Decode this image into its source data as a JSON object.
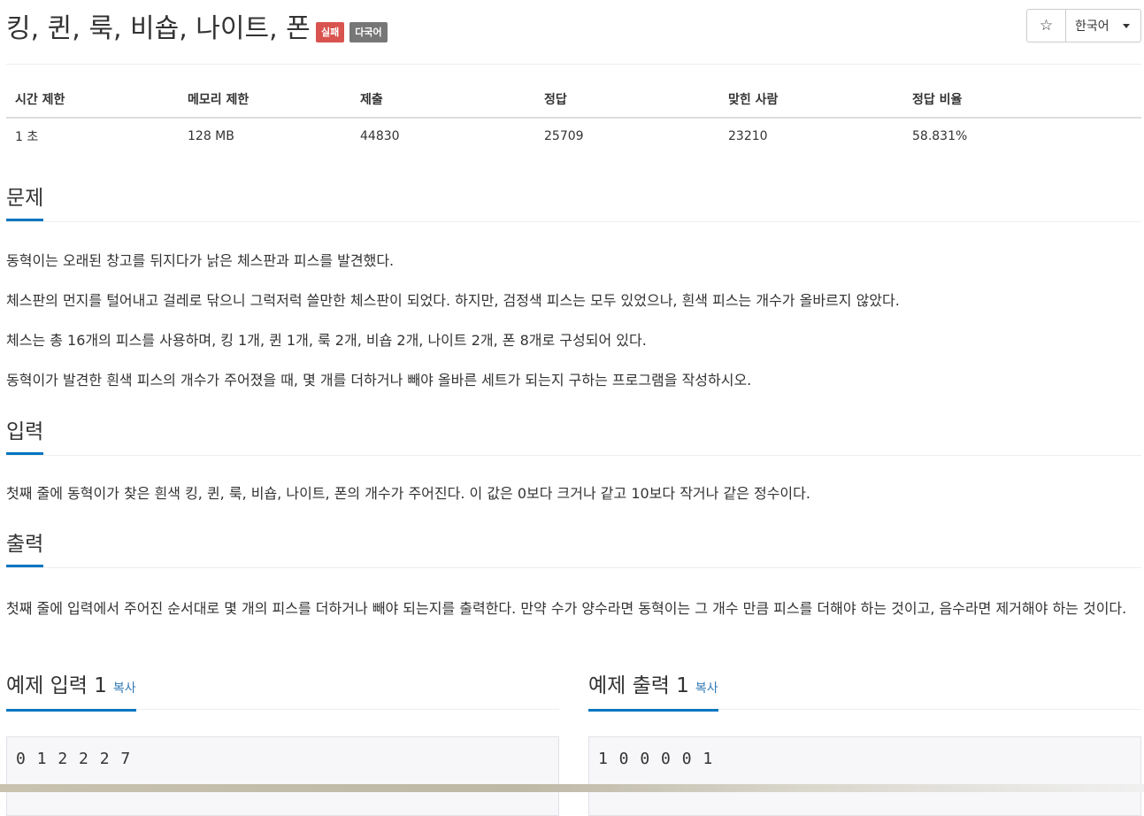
{
  "header": {
    "title": "킹, 퀸, 룩, 비숍, 나이트, 폰",
    "labels": [
      "실패",
      "다국어"
    ],
    "star_icon": "☆",
    "language": "한국어"
  },
  "info_table": {
    "columns": [
      "시간 제한",
      "메모리 제한",
      "제출",
      "정답",
      "맞힌 사람",
      "정답 비율"
    ],
    "row": [
      "1 초",
      "128 MB",
      "44830",
      "25709",
      "23210",
      "58.831%"
    ]
  },
  "problem": {
    "heading": "문제",
    "paragraphs": [
      "동혁이는 오래된 창고를 뒤지다가 낡은 체스판과 피스를 발견했다.",
      "체스판의 먼지를 털어내고 걸레로 닦으니 그럭저럭 쓸만한 체스판이 되었다. 하지만, 검정색 피스는 모두 있었으나, 흰색 피스는 개수가 올바르지 않았다.",
      "체스는 총 16개의 피스를 사용하며, 킹 1개, 퀸 1개, 룩 2개, 비숍 2개, 나이트 2개, 폰 8개로 구성되어 있다.",
      "동혁이가 발견한 흰색 피스의 개수가 주어졌을 때, 몇 개를 더하거나 빼야 올바른 세트가 되는지 구하는 프로그램을 작성하시오."
    ]
  },
  "input": {
    "heading": "입력",
    "text": "첫째 줄에 동혁이가 찾은 흰색 킹, 퀸, 룩, 비숍, 나이트, 폰의 개수가 주어진다. 이 값은 0보다 크거나 같고 10보다 작거나 같은 정수이다."
  },
  "output": {
    "heading": "출력",
    "text": "첫째 줄에 입력에서 주어진 순서대로 몇 개의 피스를 더하거나 빼야 되는지를 출력한다. 만약 수가 양수라면 동혁이는 그 개수 만큼 피스를 더해야 하는 것이고, 음수라면 제거해야 하는 것이다."
  },
  "samples": {
    "input_heading": "예제 입력 1",
    "output_heading": "예제 출력 1",
    "copy_label": "복사",
    "input_data": "0 1 2 2 2 7",
    "output_data": "1 0 0 0 0 1"
  }
}
